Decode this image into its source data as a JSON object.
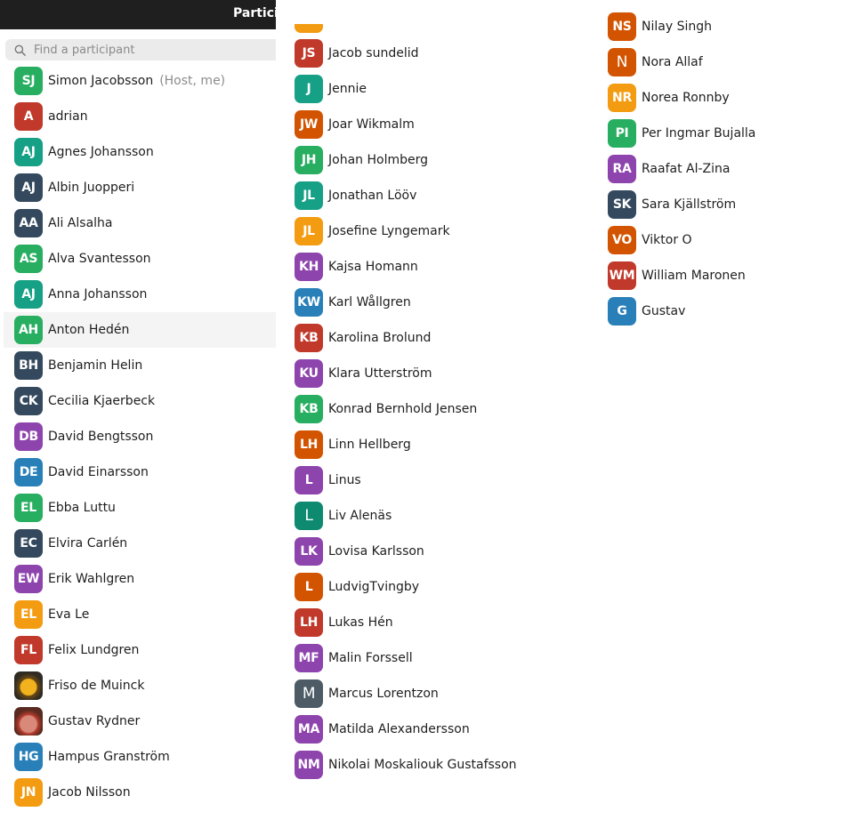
{
  "header": {
    "title": "Particip"
  },
  "search": {
    "placeholder": "Find a participant"
  },
  "colors": {
    "green": "#27ae60",
    "red": "#c0392b",
    "teal": "#16a085",
    "navy": "#34495e",
    "purple": "#8e44ad",
    "blue": "#2980b9",
    "orange": "#f39c12",
    "dark_orange": "#d35400",
    "dark_teal": "#0e8a70",
    "slate": "#4d5b66"
  },
  "columns": [
    [
      {
        "initials": "SJ",
        "name": "Simon Jacobsson",
        "role": "(Host, me)",
        "color": "green"
      },
      {
        "initials": "A",
        "name": "adrian",
        "color": "red"
      },
      {
        "initials": "AJ",
        "name": "Agnes Johansson",
        "color": "teal"
      },
      {
        "initials": "AJ",
        "name": "Albin Juopperi",
        "color": "navy"
      },
      {
        "initials": "AA",
        "name": "Ali Alsalha",
        "color": "navy"
      },
      {
        "initials": "AS",
        "name": "Alva Svantesson",
        "color": "green"
      },
      {
        "initials": "AJ",
        "name": "Anna Johansson",
        "color": "teal"
      },
      {
        "initials": "AH",
        "name": "Anton Hedén",
        "color": "green",
        "hover": true
      },
      {
        "initials": "BH",
        "name": "Benjamin Helin",
        "color": "navy"
      },
      {
        "initials": "CK",
        "name": "Cecilia Kjaerbeck",
        "color": "navy"
      },
      {
        "initials": "DB",
        "name": "David Bengtsson",
        "color": "purple"
      },
      {
        "initials": "DE",
        "name": "David Einarsson",
        "color": "blue"
      },
      {
        "initials": "EL",
        "name": "Ebba Luttu",
        "color": "green"
      },
      {
        "initials": "EC",
        "name": "Elvira Carlén",
        "color": "navy"
      },
      {
        "initials": "EW",
        "name": "Erik Wahlgren",
        "color": "purple"
      },
      {
        "initials": "EL",
        "name": "Eva Le",
        "color": "orange"
      },
      {
        "initials": "FL",
        "name": "Felix Lundgren",
        "color": "red"
      },
      {
        "initials": "",
        "name": "Friso de Muinck",
        "color": "navy",
        "photo": "photo1"
      },
      {
        "initials": "",
        "name": "Gustav Rydner",
        "color": "red",
        "photo": "photo2"
      },
      {
        "initials": "HG",
        "name": "Hampus Granström",
        "color": "blue"
      },
      {
        "initials": "JN",
        "name": "Jacob Nilsson",
        "color": "orange"
      }
    ],
    [
      {
        "initials": "JS",
        "name": "Jacob sundelid",
        "color": "red"
      },
      {
        "initials": "J",
        "name": "Jennie",
        "color": "teal"
      },
      {
        "initials": "JW",
        "name": "Joar Wikmalm",
        "color": "dark_orange"
      },
      {
        "initials": "JH",
        "name": "Johan Holmberg",
        "color": "green"
      },
      {
        "initials": "JL",
        "name": "Jonathan Lööv",
        "color": "teal"
      },
      {
        "initials": "JL",
        "name": "Josefine Lyngemark",
        "color": "orange"
      },
      {
        "initials": "KH",
        "name": "Kajsa Homann",
        "color": "purple"
      },
      {
        "initials": "KW",
        "name": "Karl Wållgren",
        "color": "blue"
      },
      {
        "initials": "KB",
        "name": "Karolina Brolund",
        "color": "red"
      },
      {
        "initials": "KU",
        "name": "Klara Utterström",
        "color": "purple"
      },
      {
        "initials": "KB",
        "name": "Konrad Bernhold Jensen",
        "color": "green"
      },
      {
        "initials": "LH",
        "name": "Linn Hellberg",
        "color": "dark_orange"
      },
      {
        "initials": "L",
        "name": "Linus",
        "color": "purple"
      },
      {
        "initials": "L",
        "name": "Liv Alenäs",
        "color": "dark_teal",
        "light": true
      },
      {
        "initials": "LK",
        "name": "Lovisa Karlsson",
        "color": "purple"
      },
      {
        "initials": "L",
        "name": "LudvigTvingby",
        "color": "dark_orange"
      },
      {
        "initials": "LH",
        "name": "Lukas Hén",
        "color": "red"
      },
      {
        "initials": "MF",
        "name": "Malin Forssell",
        "color": "purple"
      },
      {
        "initials": "M",
        "name": "Marcus Lorentzon",
        "color": "slate",
        "light": true
      },
      {
        "initials": "MA",
        "name": "Matilda Alexandersson",
        "color": "purple"
      },
      {
        "initials": "NM",
        "name": "Nikolai Moskaliouk Gustafsson",
        "color": "purple"
      }
    ],
    [
      {
        "initials": "NS",
        "name": "Nilay Singh",
        "color": "dark_orange"
      },
      {
        "initials": "N",
        "name": "Nora Allaf",
        "color": "dark_orange",
        "light": true
      },
      {
        "initials": "NR",
        "name": "Norea Ronnby",
        "color": "orange"
      },
      {
        "initials": "PI",
        "name": "Per Ingmar Bujalla",
        "color": "green"
      },
      {
        "initials": "RA",
        "name": "Raafat Al-Zina",
        "color": "purple"
      },
      {
        "initials": "SK",
        "name": "Sara Kjällström",
        "color": "navy"
      },
      {
        "initials": "VO",
        "name": "Viktor O",
        "color": "dark_orange"
      },
      {
        "initials": "WM",
        "name": "William Maronen",
        "color": "red"
      },
      {
        "initials": "G",
        "name": "Gustav",
        "color": "blue"
      }
    ]
  ]
}
